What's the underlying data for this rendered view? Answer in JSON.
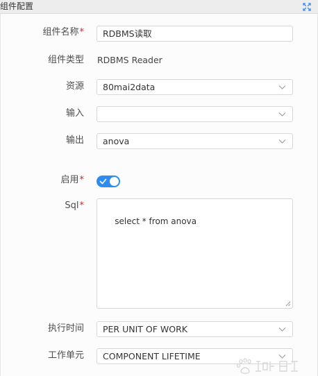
{
  "panel": {
    "title": "组件配置"
  },
  "form": {
    "name": {
      "label": "组件名称",
      "required_mark": "*",
      "value": "RDBMS读取"
    },
    "type": {
      "label": "组件类型",
      "value": "RDBMS Reader"
    },
    "resource": {
      "label": "资源",
      "value": "80mai2data"
    },
    "input": {
      "label": "输入",
      "value": ""
    },
    "output": {
      "label": "输出",
      "value": "anova"
    },
    "enabled": {
      "label": "启用",
      "required_mark": "*",
      "on": true
    },
    "sql": {
      "label": "Sql",
      "required_mark": "*",
      "value": "select * from anova"
    },
    "exec_time": {
      "label": "执行时间",
      "value": "PER UNIT OF WORK"
    },
    "work_unit": {
      "label": "工作单元",
      "value": "COMPONENT LIFETIME"
    }
  },
  "icons": {
    "collapse": "collapse-arrows-icon",
    "dropdown": "chevron-down-icon",
    "toggle_check": "check-icon",
    "resize": "resize-grip-icon",
    "watermark": "baidu-watermark"
  },
  "colors": {
    "accent": "#2d8cf0",
    "required": "#e02020"
  }
}
